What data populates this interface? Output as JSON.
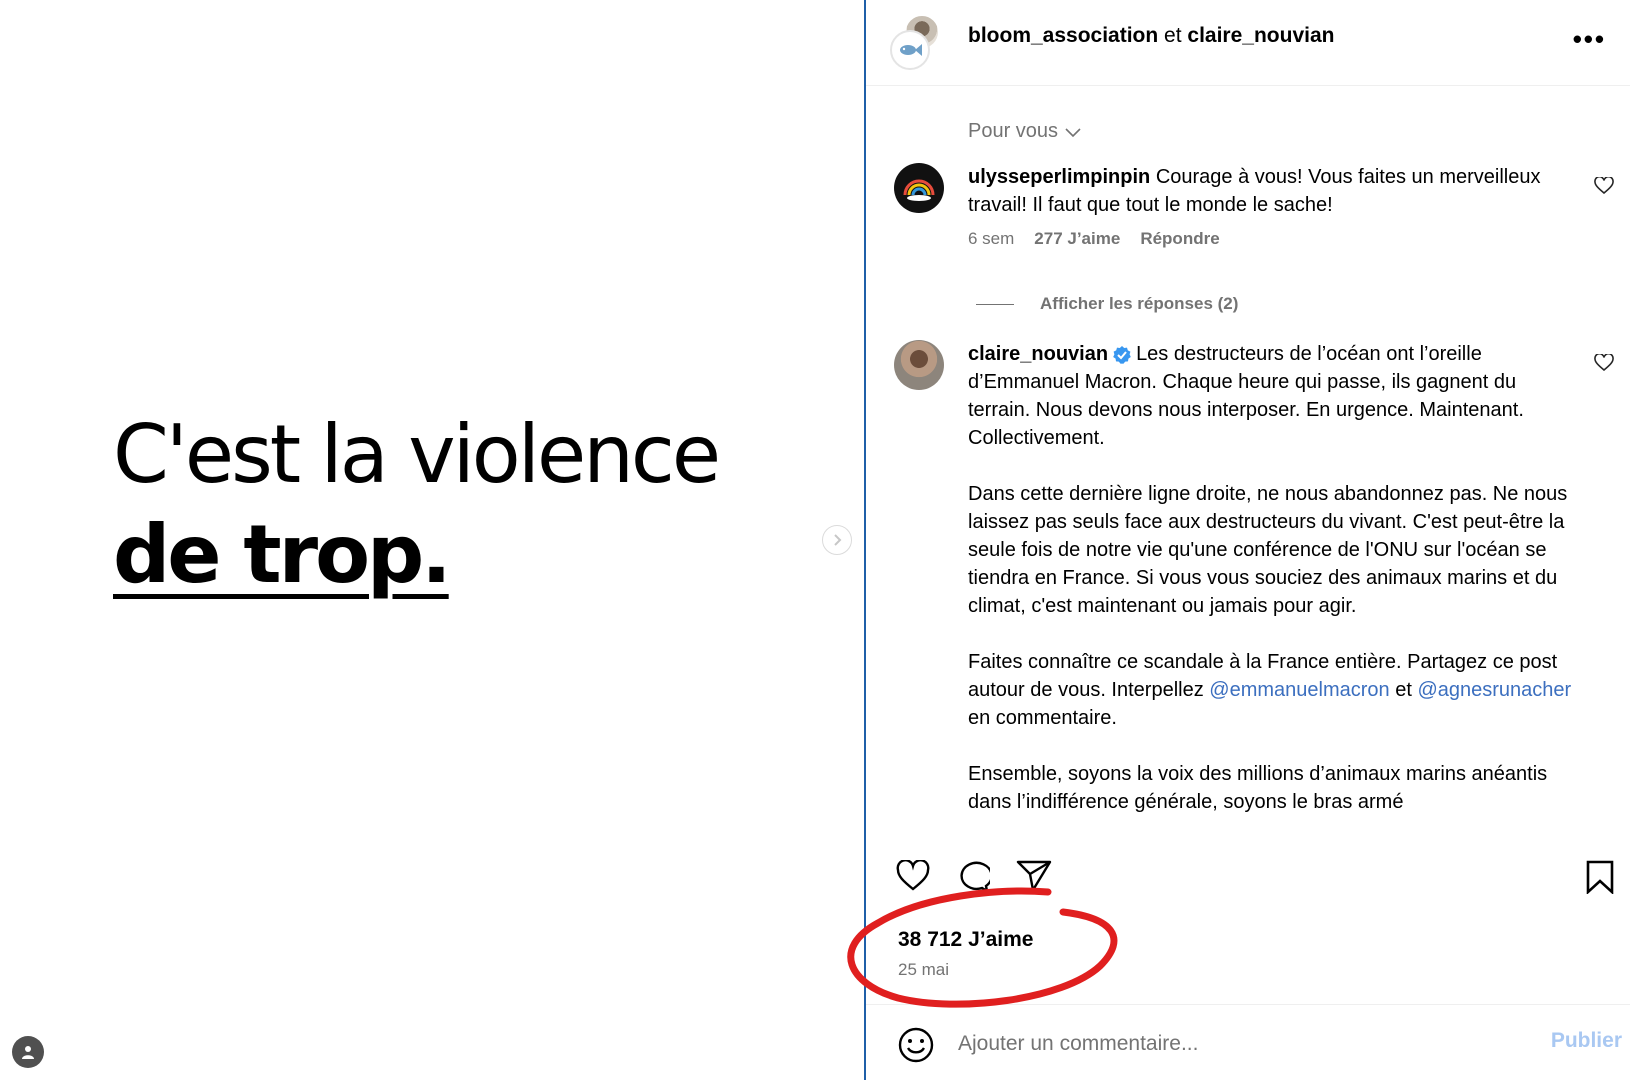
{
  "media": {
    "headline_line1": "C'est la violence",
    "headline_line2": "de trop."
  },
  "header": {
    "user1": "bloom_association",
    "joiner": " et ",
    "user2": "claire_nouvian",
    "more_label": "•••"
  },
  "sort": {
    "label": "Pour vous"
  },
  "comments": [
    {
      "username": "ulysseperlimpinpin",
      "text": "Courage à vous! Vous faites un merveilleux travail! Il faut que tout le monde le sache!",
      "time": "6 sem",
      "likes": "277 J’aime",
      "reply": "Répondre",
      "view_replies": "Afficher les réponses (2)"
    }
  ],
  "caption": {
    "username": "claire_nouvian",
    "p1": "Les destructeurs de l’océan ont l’oreille d’Emmanuel Macron. Chaque heure qui passe, ils gagnent du terrain. Nous devons nous interposer. En urgence. Maintenant. Collectivement.",
    "p2": "Dans cette dernière ligne droite, ne nous abandonnez pas. Ne nous laissez pas seuls face aux destructeurs du vivant. C'est peut-être la seule fois de notre vie qu'une conférence de l'ONU sur l'océan se tiendra en France. Si vous vous souciez des animaux marins et du climat, c'est maintenant ou jamais pour agir.",
    "p3_a": "Faites connaître ce scandale à la France entière. Partagez ce post autour de vous. Interpellez ",
    "mention1": "@emmanuelmacron",
    "p3_b": " et ",
    "mention2": "@agnesrunacher",
    "p3_c": " en commentaire.",
    "p4": "Ensemble, soyons la voix des millions d’animaux marins anéantis dans l’indifférence générale, soyons le bras armé"
  },
  "stats": {
    "likes": "38 712 J’aime",
    "date": "25 mai"
  },
  "composer": {
    "placeholder": "Ajouter un commentaire...",
    "publish": "Publier"
  },
  "colors": {
    "annotation": "#e01f1f",
    "mention": "#3c6fbf",
    "verified": "#3897f0",
    "panel_divider": "#1f5fa8"
  }
}
